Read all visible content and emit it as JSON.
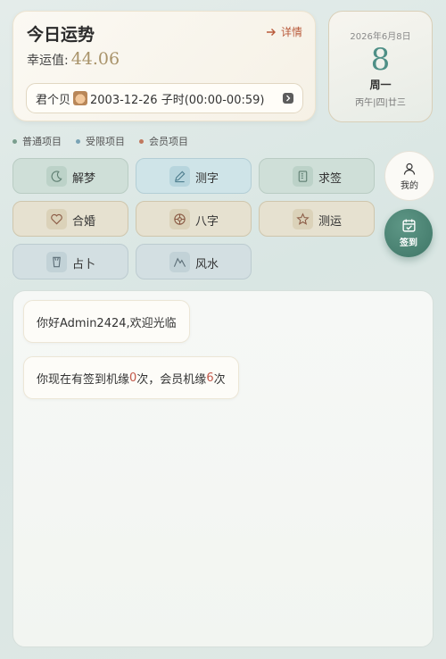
{
  "fortune": {
    "title": "今日运势",
    "detail_label": "详情",
    "luck_label": "幸运值:",
    "luck_value": "44.06",
    "profile": {
      "name": "君个贝",
      "info": "2003-12-26 子时(00:00-00:59)"
    }
  },
  "date_card": {
    "full_date": "2026年6月8日",
    "day": "8",
    "weekday": "周一",
    "lunar": "丙午|四|廿三"
  },
  "legend": [
    {
      "label": "普通项目",
      "color": "#7a9e8e"
    },
    {
      "label": "受限项目",
      "color": "#7aa3b5"
    },
    {
      "label": "会员项目",
      "color": "#c0785e"
    }
  ],
  "tiles": [
    {
      "label": "解梦",
      "icon": "moon-icon",
      "category": "normal"
    },
    {
      "label": "测字",
      "icon": "pen-icon",
      "category": "restricted"
    },
    {
      "label": "求签",
      "icon": "lot-icon",
      "category": "normal"
    },
    {
      "label": "合婚",
      "icon": "heart-icon",
      "category": "member"
    },
    {
      "label": "八字",
      "icon": "compass-icon",
      "category": "member"
    },
    {
      "label": "测运",
      "icon": "star-icon",
      "category": "member"
    },
    {
      "label": "占卜",
      "icon": "cup-icon",
      "category": "other"
    },
    {
      "label": "风水",
      "icon": "mountain-icon",
      "category": "other"
    }
  ],
  "side": {
    "mine_label": "我的",
    "sign_label": "签到"
  },
  "chat": {
    "greeting": "你好Admin2424,欢迎光临",
    "sign_prefix": "你现在有签到机缘",
    "sign_count": "0",
    "sign_mid": "次，会员机缘",
    "member_count": "6",
    "sign_suffix": "次"
  }
}
